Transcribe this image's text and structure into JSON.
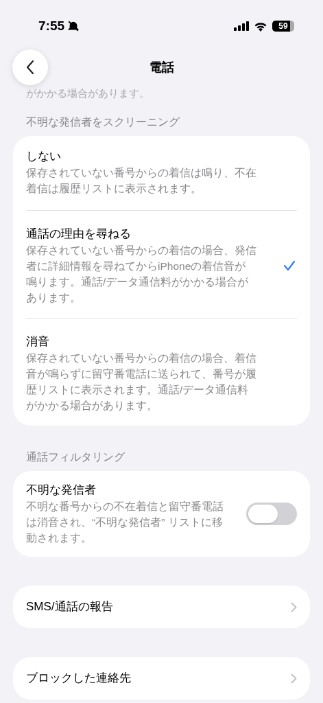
{
  "status_bar": {
    "time": "7:55",
    "battery": "59"
  },
  "nav": {
    "title": "電話"
  },
  "behind_text": "がかかる場合があります。",
  "screening": {
    "header": "不明な発信者をスクリーニング",
    "options": [
      {
        "title": "しない",
        "description": "保存されていない番号からの着信は鳴り、不在着信は履歴リストに表示されます。",
        "selected": false
      },
      {
        "title": "通話の理由を尋ねる",
        "description": "保存されていない番号からの着信の場合、発信者に詳細情報を尋ねてからiPhoneの着信音が鳴ります。通話/データ通信料がかかる場合があります。",
        "selected": true
      },
      {
        "title": "消音",
        "description": "保存されていない番号からの着信の場合、着信音が鳴らずに留守番電話に送られて、番号が履歴リストに表示されます。通話/データ通信料がかかる場合があります。",
        "selected": false
      }
    ]
  },
  "filtering": {
    "header": "通話フィルタリング",
    "title": "不明な発信者",
    "description": "不明な番号からの不在着信と留守番電話は消音され、“不明な発信者” リストに移動されます。",
    "on": false
  },
  "links": [
    {
      "label": "SMS/通話の報告"
    },
    {
      "label": "ブロックした連絡先"
    }
  ]
}
